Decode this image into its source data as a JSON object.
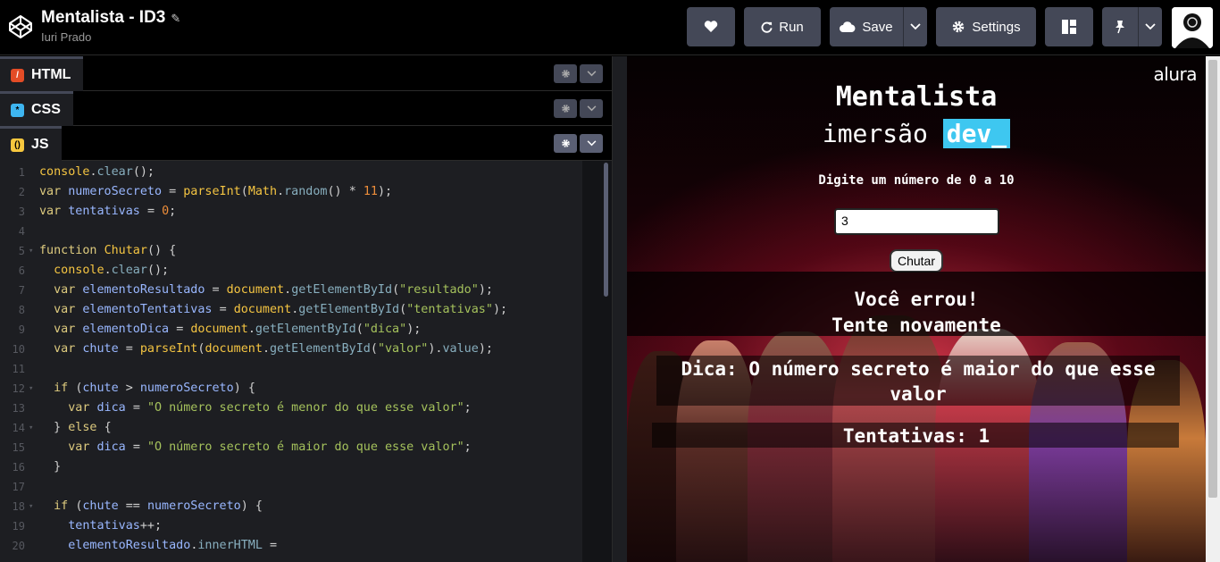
{
  "header": {
    "title": "Mentalista - ID3",
    "author": "Iuri Prado",
    "run_label": "Run",
    "save_label": "Save",
    "settings_label": "Settings"
  },
  "editors": {
    "html_label": "HTML",
    "css_label": "CSS",
    "js_label": "JS"
  },
  "code_lines": [
    "console.clear();",
    "var numeroSecreto = parseInt(Math.random() * 11);",
    "var tentativas = 0;",
    "",
    "function Chutar() {",
    "  console.clear();",
    "  var elementoResultado = document.getElementById(\"resultado\");",
    "  var elementoTentativas = document.getElementById(\"tentativas\");",
    "  var elementoDica = document.getElementById(\"dica\");",
    "  var chute = parseInt(document.getElementById(\"valor\").value);",
    "",
    "  if (chute > numeroSecreto) {",
    "    var dica = \"O número secreto é menor do que esse valor\";",
    "  } else {",
    "    var dica = \"O número secreto é maior do que esse valor\";",
    "  }",
    "",
    "  if (chute == numeroSecreto) {",
    "    tentativas++;",
    "    elementoResultado.innerHTML ="
  ],
  "preview": {
    "brand": "alura",
    "title": "Mentalista",
    "subtitle_prefix": "imersão",
    "subtitle_tag": "dev_",
    "prompt": "Digite um número de 0 a 10",
    "input_value": "3",
    "button_label": "Chutar",
    "result_line1": "Você errou!",
    "result_line2": "Tente novamente",
    "dica": "Dica: O número secreto é maior do que esse valor",
    "tentativas": "Tentativas: 1"
  },
  "colors": {
    "accent_dev": "#3ec7f0",
    "button_bg": "#444857",
    "html_badge": "#e34c26",
    "css_badge": "#3eb5f0",
    "js_badge": "#f7c73e"
  }
}
